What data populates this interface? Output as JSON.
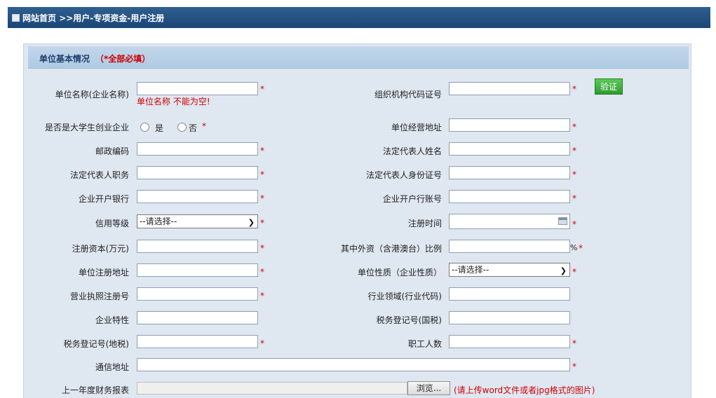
{
  "header": {
    "home": "网站首页",
    "breadcrumb": " >>用户-专项资金-用户注册"
  },
  "section": {
    "title": "单位基本情况",
    "note": "（*全部必填）"
  },
  "required_mark": "*",
  "error_unit_name": "单位名称  不能为空!",
  "verify_button": "验证",
  "radio": {
    "yes": "是",
    "no": "否"
  },
  "labels": {
    "unit_name": "单位名称(企业名称)",
    "org_code": "组织机构代码证号",
    "student_startup": "是否是大学生创业企业",
    "business_address": "单位经营地址",
    "postcode": "邮政编码",
    "legal_rep_name": "法定代表人姓名",
    "legal_rep_title": "法定代表人职务",
    "legal_rep_id": "法定代表人身份证号",
    "bank": "企业开户银行",
    "bank_account": "企业开户行账号",
    "credit_level": "信用等级",
    "reg_date": "注册时间",
    "reg_capital": "注册资本(万元)",
    "foreign_ratio": "其中外资（含港澳台）比例",
    "reg_address": "单位注册地址",
    "nature": "单位性质（企业性质）",
    "license_no": "营业执照注册号",
    "industry": "行业领域(行业代码)",
    "features": "企业特性",
    "tax_national": "税务登记号(国税)",
    "tax_local": "税务登记号(地税)",
    "staff_count": "职工人数",
    "mail_address": "通信地址",
    "last_year_report": "上一年度财务报表"
  },
  "select_placeholder": "--请选择--",
  "percent": "%",
  "browse_button": "浏览...",
  "upload_hint": "(请上传word文件或者jpg格式的图片)"
}
